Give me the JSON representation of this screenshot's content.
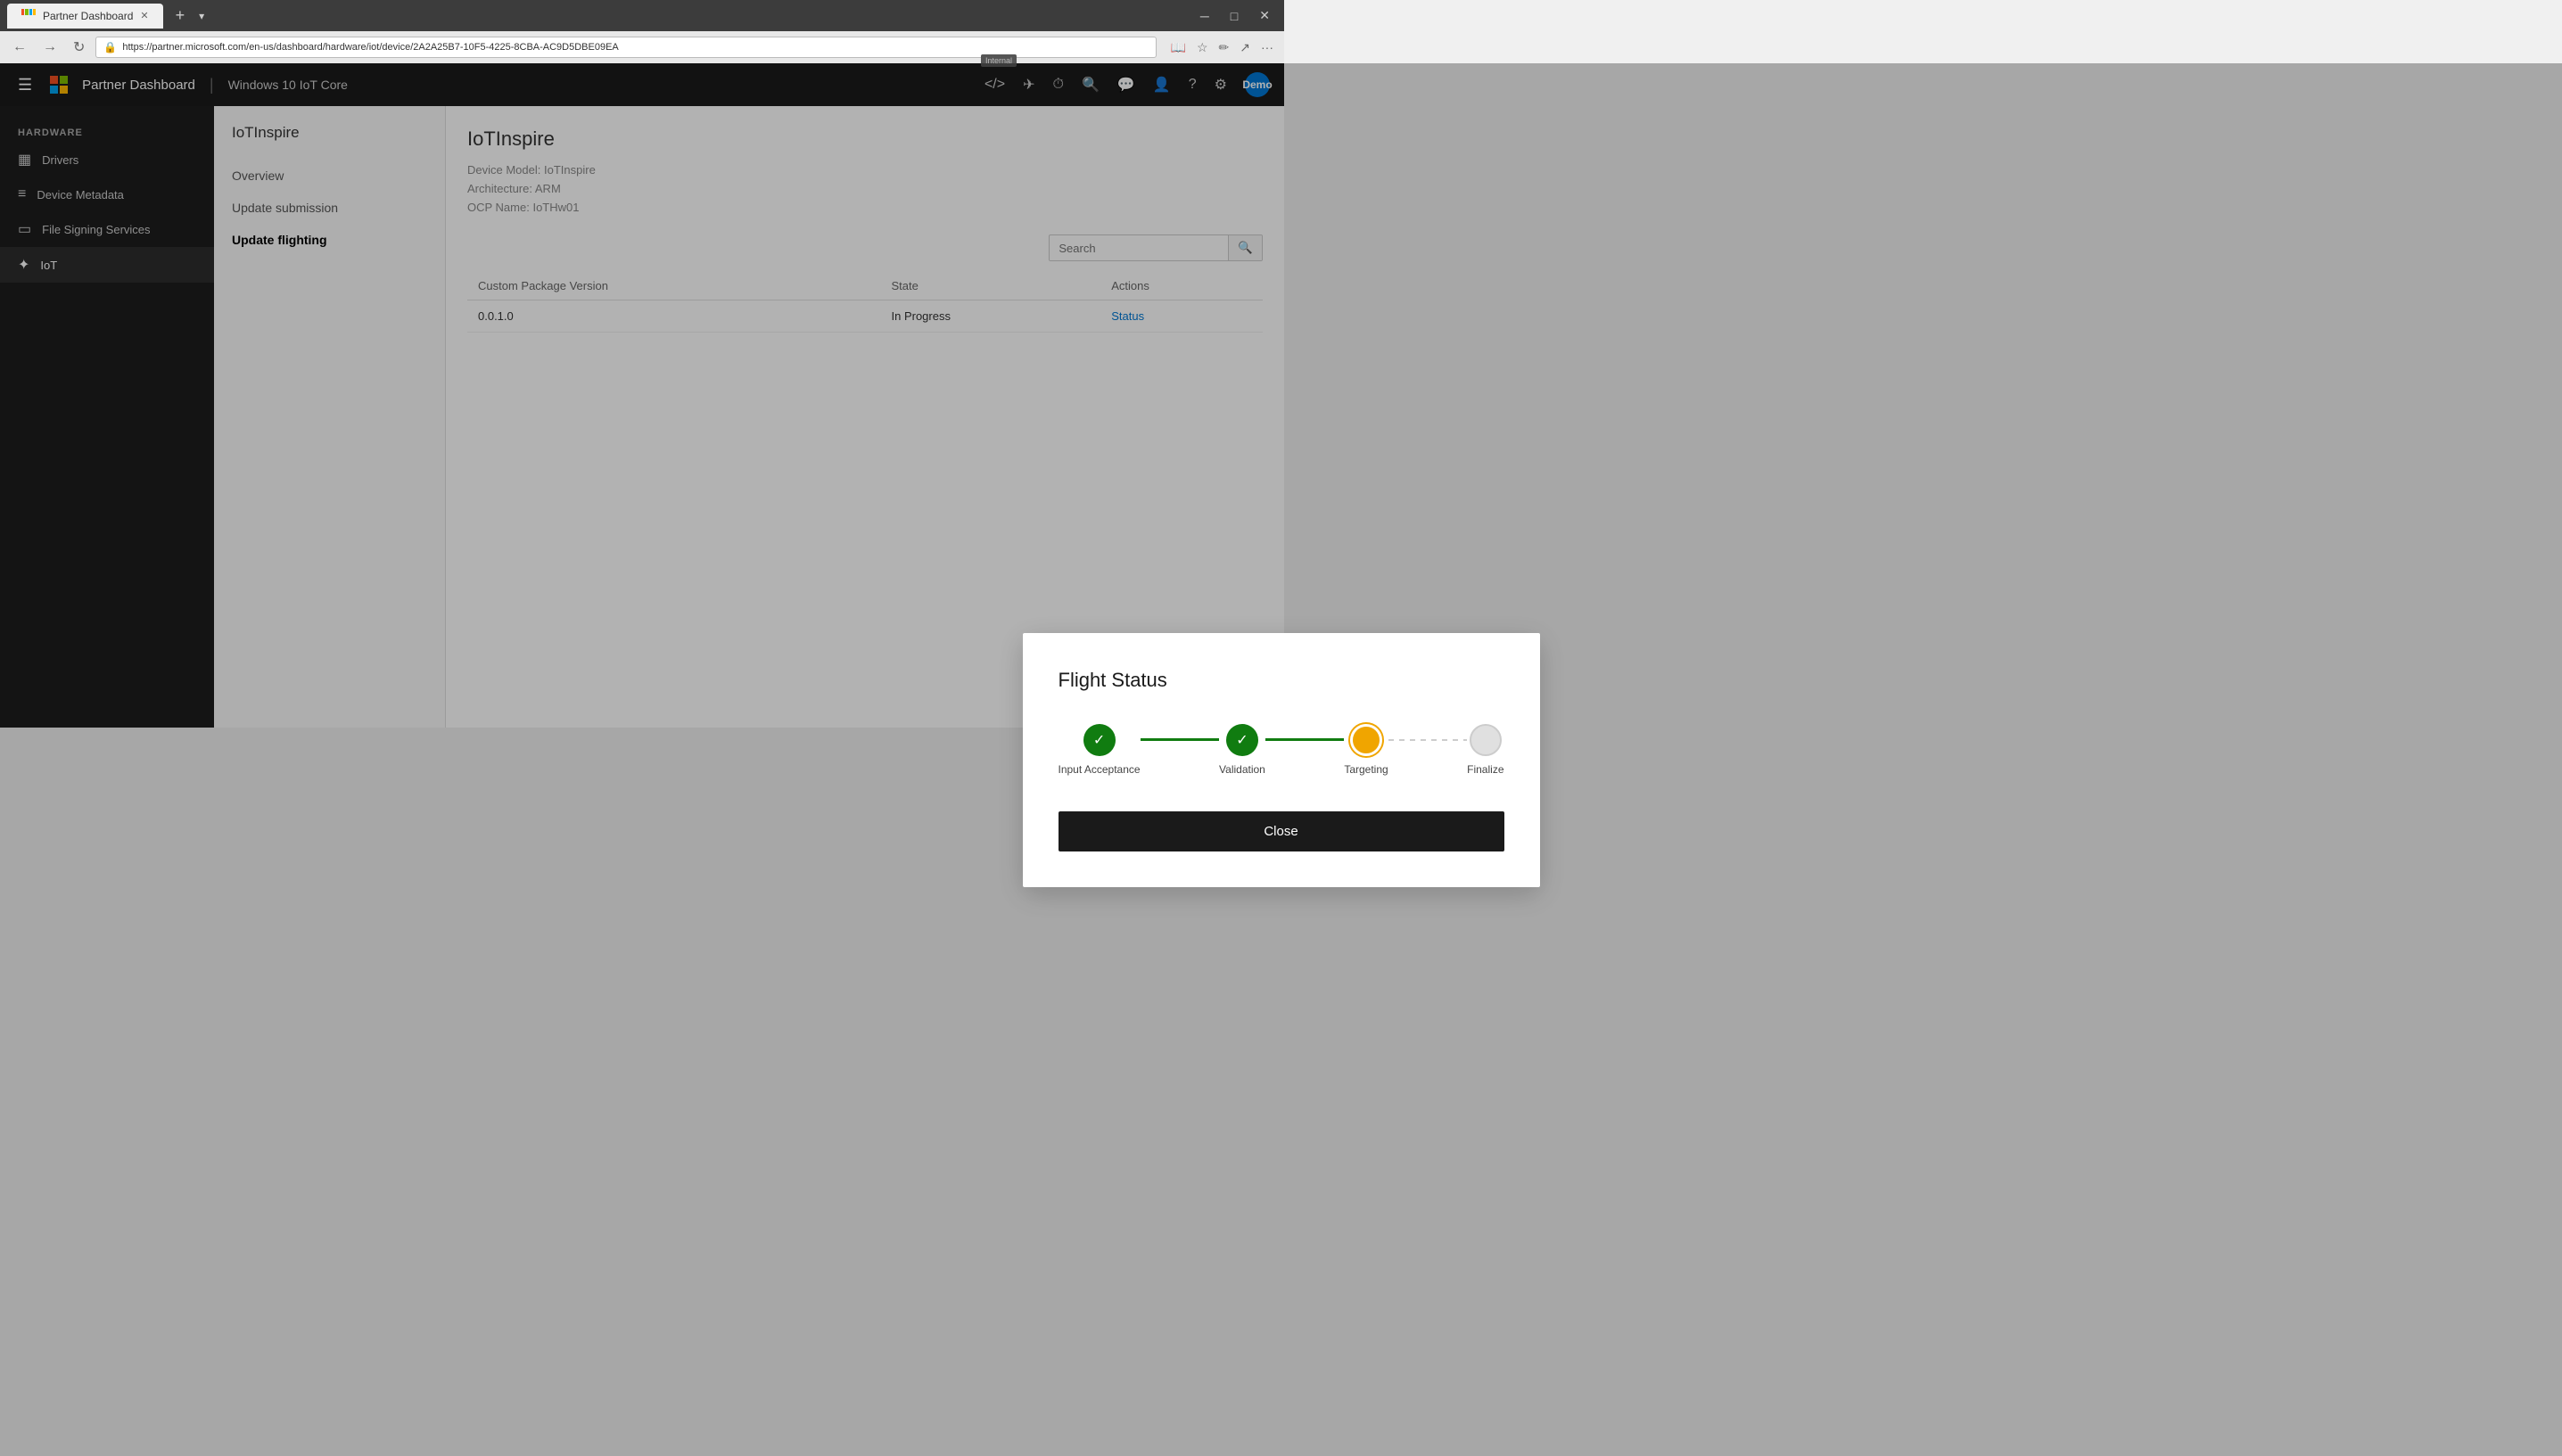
{
  "browser": {
    "tab_label": "Partner Dashboard",
    "url": "https://partner.microsoft.com/en-us/dashboard/hardware/iot/device/2A2A25B7-10F5-4225-8CBA-AC9D5DBE09EA",
    "new_tab_label": "+",
    "back_label": "←",
    "forward_label": "→",
    "refresh_label": "↻",
    "home_label": "⌂",
    "internal_badge": "Internal",
    "user_label": "Demo"
  },
  "topnav": {
    "title": "Partner Dashboard",
    "subtitle": "Windows 10 IoT Core",
    "code_icon": "</>",
    "nav_icon1": "✈",
    "nav_icon2": "⏱",
    "nav_icon3": "🔍",
    "nav_icon4": "💬",
    "nav_icon5": "👤",
    "nav_icon6": "?",
    "nav_icon7": "⚙"
  },
  "sidebar": {
    "section_label": "HARDWARE",
    "items": [
      {
        "label": "Drivers",
        "icon": "▦"
      },
      {
        "label": "Device Metadata",
        "icon": "≡"
      },
      {
        "label": "File Signing Services",
        "icon": "▭"
      },
      {
        "label": "IoT",
        "icon": "✦"
      }
    ]
  },
  "sub_sidebar": {
    "title": "IoTInspire",
    "nav_items": [
      {
        "label": "Overview",
        "active": false
      },
      {
        "label": "Update submission",
        "active": false
      },
      {
        "label": "Update flighting",
        "active": true
      }
    ]
  },
  "device": {
    "title": "IoTInspire",
    "model_label": "Device Model:",
    "model_value": "IoTInspire",
    "arch_label": "Architecture:",
    "arch_value": "ARM",
    "ocp_label": "OCP Name:",
    "ocp_value": "IoTHw01"
  },
  "table": {
    "search_placeholder": "Search",
    "columns": [
      {
        "label": "Custom Package Version"
      },
      {
        "label": "State"
      },
      {
        "label": "Actions"
      }
    ],
    "rows": [
      {
        "version": "0.0.1.0",
        "state": "In Progress",
        "action": "Status"
      }
    ]
  },
  "modal": {
    "title": "Flight Status",
    "steps": [
      {
        "label": "Input Acceptance",
        "state": "completed"
      },
      {
        "label": "Validation",
        "state": "completed"
      },
      {
        "label": "Targeting",
        "state": "in-progress"
      },
      {
        "label": "Finalize",
        "state": "pending"
      }
    ],
    "close_label": "Close"
  }
}
